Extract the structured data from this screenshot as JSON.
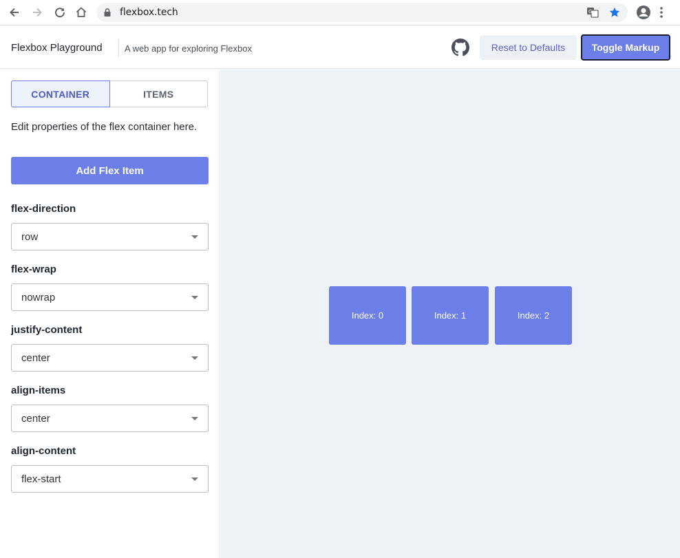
{
  "browser": {
    "url": "flexbox.tech"
  },
  "header": {
    "title": "Flexbox Playground",
    "subtitle": "A web app for exploring Flexbox",
    "reset_label": "Reset to Defaults",
    "toggle_label": "Toggle Markup"
  },
  "sidebar": {
    "tabs": [
      {
        "label": "CONTAINER",
        "active": true
      },
      {
        "label": "ITEMS",
        "active": false
      }
    ],
    "description": "Edit properties of the flex container here.",
    "add_button": "Add Flex Item",
    "properties": [
      {
        "label": "flex-direction",
        "value": "row"
      },
      {
        "label": "flex-wrap",
        "value": "nowrap"
      },
      {
        "label": "justify-content",
        "value": "center"
      },
      {
        "label": "align-items",
        "value": "center"
      },
      {
        "label": "align-content",
        "value": "flex-start"
      }
    ]
  },
  "preview": {
    "items": [
      {
        "label": "Index: 0"
      },
      {
        "label": "Index: 1"
      },
      {
        "label": "Index: 2"
      }
    ]
  },
  "colors": {
    "accent": "#6c7ee8",
    "preview_bg": "#eef1f5",
    "star": "#1a73e8"
  }
}
